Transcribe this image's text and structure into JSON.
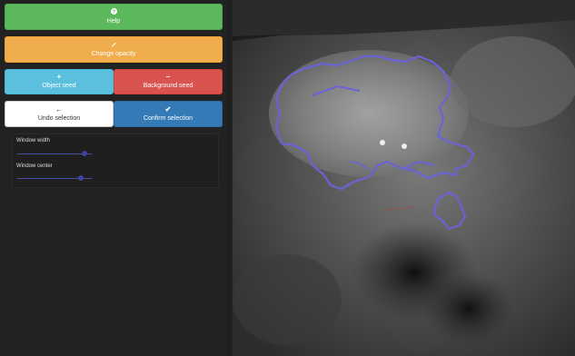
{
  "buttons": {
    "help": "Help",
    "opacity": "Change opacity",
    "object_seed": "Object seed",
    "background_seed": "Background seed",
    "undo": "Undo selection",
    "confirm": "Confirm selection"
  },
  "sliders": {
    "window_width": {
      "label": "Window width",
      "value": 0.9
    },
    "window_center": {
      "label": "Window center",
      "value": 0.85
    }
  },
  "colors": {
    "help": "#5cb85c",
    "opacity": "#f0ad4e",
    "object_seed": "#5bc0de",
    "background_seed": "#d9534f",
    "confirm": "#337ab7",
    "segmentation_outline": "#6a63d6"
  },
  "icons": {
    "help": "question-circle-icon",
    "opacity": "pencil-icon",
    "object_seed": "plus-icon",
    "background_seed": "minus-icon",
    "undo": "arrow-left-icon",
    "confirm": "checkmark-icon"
  }
}
